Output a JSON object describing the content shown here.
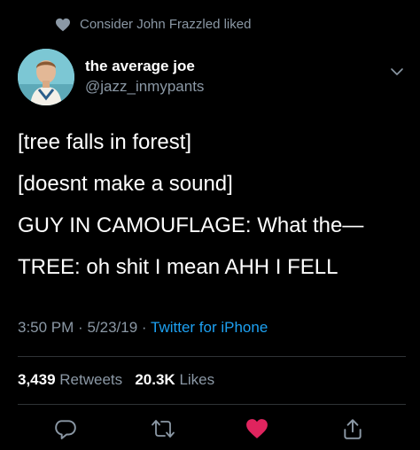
{
  "social_context": {
    "text": "Consider John Frazzled liked",
    "icon": "heart-icon"
  },
  "author": {
    "display_name": "the average joe",
    "handle": "@jazz_inmypants",
    "avatar_icon": "avatar-icon",
    "menu_icon": "chevron-down-icon"
  },
  "tweet": {
    "lines": [
      "[tree falls in forest]",
      "[doesnt make a sound]",
      "GUY IN CAMOUFLAGE: What the—",
      "TREE: oh shit I mean AHH I FELL"
    ]
  },
  "meta": {
    "time": "3:50 PM",
    "separator": "·",
    "date": "5/23/19",
    "source": "Twitter for iPhone"
  },
  "stats": {
    "retweets_count": "3,439",
    "retweets_label": "Retweets",
    "likes_count": "20.3K",
    "likes_label": "Likes"
  },
  "actions": {
    "reply_icon": "reply-icon",
    "retweet_icon": "retweet-icon",
    "like_icon": "heart-icon",
    "share_icon": "share-icon"
  },
  "colors": {
    "background": "#000000",
    "text": "#ffffff",
    "secondary": "#8b98a5",
    "link": "#1da1f2",
    "like": "#e0245e",
    "divider": "#2f3336"
  }
}
